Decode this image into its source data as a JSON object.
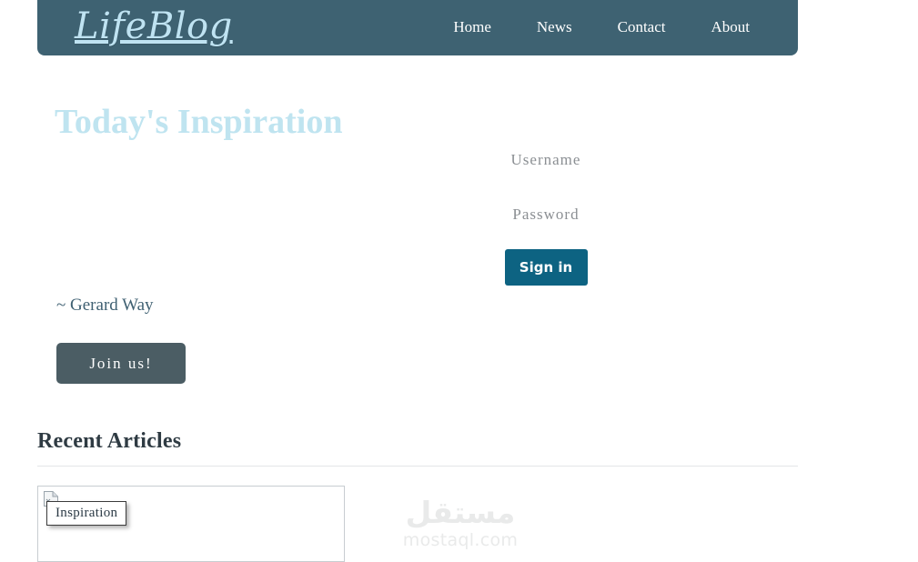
{
  "header": {
    "brand": "LifeBlog",
    "brand_color": "#bfe3f2",
    "background_color": "#3e6272",
    "nav": [
      {
        "label": "Home"
      },
      {
        "label": "News"
      },
      {
        "label": "Contact"
      },
      {
        "label": "About"
      }
    ]
  },
  "hero": {
    "title": "Today's Inspiration",
    "title_color": "#bfe4f0",
    "quote": "",
    "author": "~ Gerard Way",
    "join_label": "Join us!",
    "join_color": "#4b5d64"
  },
  "login": {
    "username_placeholder": "Username",
    "username_value": "",
    "password_placeholder": "Password",
    "password_value": "",
    "signin_label": "Sign in",
    "signin_color": "#0d6382"
  },
  "articles": {
    "title": "Recent Articles",
    "cards": [
      {
        "alt_text": "Inspiration",
        "icon": "broken-image-icon"
      }
    ]
  },
  "watermark": {
    "arabic": "مستقل",
    "latin": "mostaql.com"
  }
}
